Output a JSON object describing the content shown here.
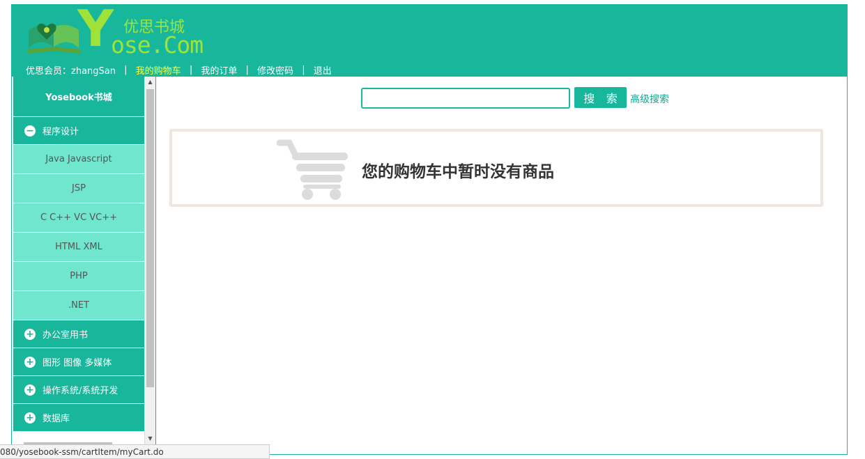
{
  "logo": {
    "slogan": "优思书城",
    "brand": "ose.Com",
    "initial": "Y"
  },
  "topnav": {
    "member_label": "优思会员：zhangSan",
    "links": [
      "我的购物车",
      "我的订单",
      "修改密码",
      "退出"
    ],
    "separator": "|"
  },
  "sidebar": {
    "title": "Yosebook书城",
    "expanded_category": {
      "label": "程序设计",
      "icon": "minus-circle-icon"
    },
    "subcategories": [
      "Java Javascript",
      "JSP",
      "C C++ VC VC++",
      "HTML XML",
      "PHP",
      ".NET"
    ],
    "collapsed_categories": [
      {
        "label": "办公室用书",
        "icon": "plus-circle-icon"
      },
      {
        "label": "图形 图像 多媒体",
        "icon": "plus-circle-icon"
      },
      {
        "label": "操作系统/系统开发",
        "icon": "plus-circle-icon"
      },
      {
        "label": "数据库",
        "icon": "plus-circle-icon"
      }
    ]
  },
  "search": {
    "value": "",
    "button_label": "搜 索",
    "advanced_label": "高级搜索"
  },
  "cart": {
    "empty_message": "您的购物车中暂时没有商品",
    "icon": "shopping-cart-icon"
  },
  "statusbar": {
    "url": "080/yosebook-ssm/cartItem/myCart.do"
  },
  "colors": {
    "accent": "#18b79c",
    "sub_bg": "#70e6cf",
    "highlight": "#ffff33",
    "cart_border": "#eee7e0"
  }
}
